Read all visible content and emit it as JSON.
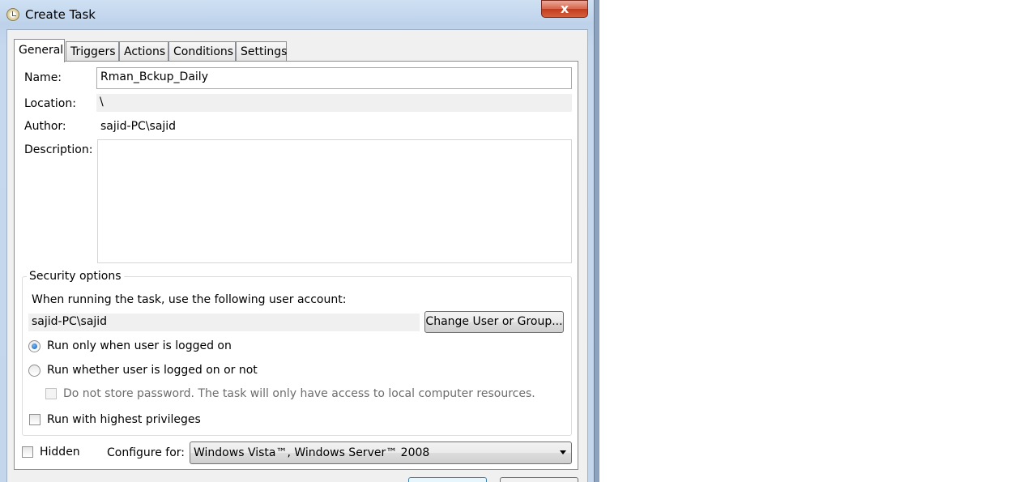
{
  "window": {
    "title": "Create Task",
    "close_label": "x"
  },
  "tabs": [
    {
      "label": "General"
    },
    {
      "label": "Triggers"
    },
    {
      "label": "Actions"
    },
    {
      "label": "Conditions"
    },
    {
      "label": "Settings"
    }
  ],
  "general": {
    "name_label": "Name:",
    "name_value": "Rman_Bckup_Daily",
    "location_label": "Location:",
    "location_value": "\\",
    "author_label": "Author:",
    "author_value": "sajid-PC\\sajid",
    "description_label": "Description:",
    "description_value": ""
  },
  "security": {
    "title": "Security options",
    "account_prompt": "When running the task, use the following user account:",
    "account_value": "sajid-PC\\sajid",
    "change_button": "Change User or Group...",
    "run_logged_on": "Run only when user is logged on",
    "run_whether": "Run whether user is logged on or not",
    "no_store_password": "Do not store password.  The task will only have access to local computer resources.",
    "highest_privileges": "Run with highest privileges"
  },
  "bottom": {
    "hidden_label": "Hidden",
    "configure_label": "Configure for:",
    "configure_value": "Windows Vista™, Windows Server™ 2008"
  }
}
